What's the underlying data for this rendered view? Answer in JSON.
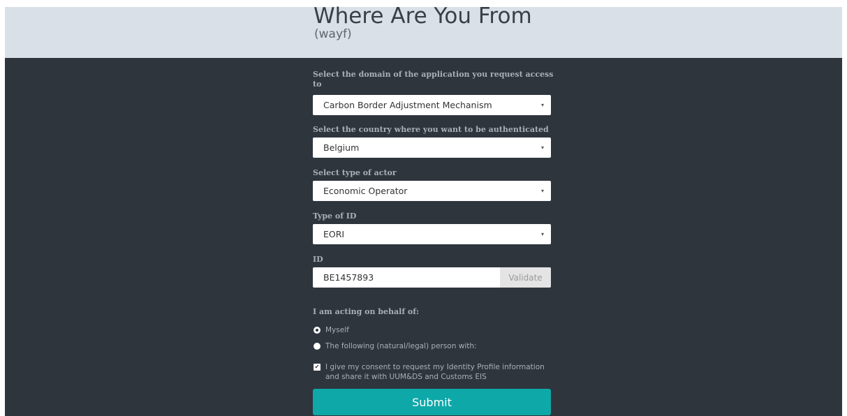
{
  "header": {
    "title": "Where Are You From",
    "subtitle": "(wayf)"
  },
  "form": {
    "domain": {
      "label": "Select the domain of the application you request access to",
      "value": "Carbon Border Adjustment Mechanism"
    },
    "country": {
      "label": "Select the country where you want to be authenticated",
      "value": "Belgium"
    },
    "actor": {
      "label": "Select type of actor",
      "value": "Economic Operator"
    },
    "id_type": {
      "label": "Type of ID",
      "value": "EORI"
    },
    "id": {
      "label": "ID",
      "value": "BE1457893",
      "validate_label": "Validate"
    },
    "behalf": {
      "label": "I am acting on behalf of:",
      "options": [
        "Myself",
        "The following (natural/legal) person with:"
      ],
      "selected": "Myself"
    },
    "consent": {
      "text": "I give my consent to request my Identity Profile information and share it with UUM&DS and Customs EIS",
      "checked": true
    },
    "submit_label": "Submit"
  },
  "icons": {
    "caret": "▾",
    "check": "✔"
  },
  "colors": {
    "header_bg": "#d9e0e8",
    "body_bg": "#2e353d",
    "submit_bg": "#0ea8a8"
  }
}
